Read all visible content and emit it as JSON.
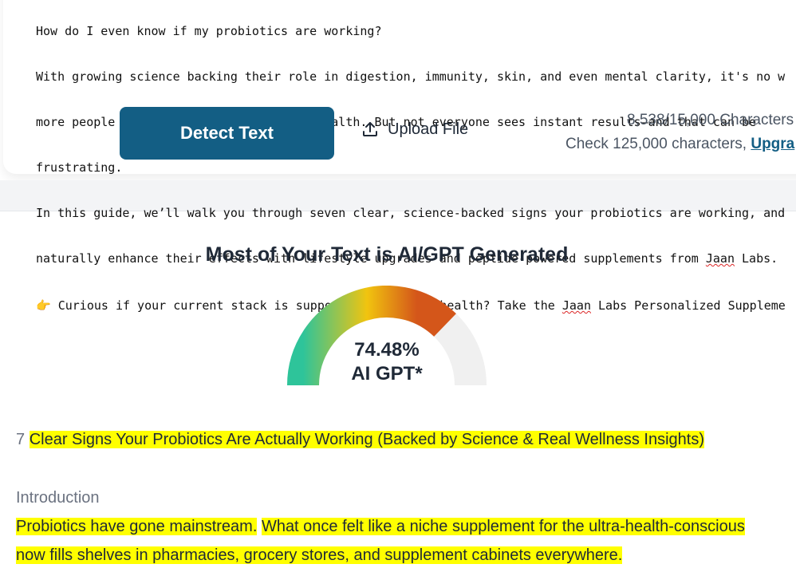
{
  "editor": {
    "lines": [
      "How do I even know if my probiotics are working?",
      "With growing science backing their role in digestion, immunity, skin, and even mental clarity, it's no w",
      "more people are investing in their gut health. But not everyone sees instant results—and that can be",
      "frustrating.",
      "In this guide, we’ll walk you through seven clear, science-backed signs your probiotics are working, and",
      "naturally enhance their effects with lifestyle upgrades and peptide-powered supplements from "
    ],
    "line6_brand": "Jaan",
    "line6_tail": " Labs.",
    "line7_emoji": "👉",
    "line7_text": " Curious if your current stack is supporting your gut health? Take the ",
    "line7_brand": "Jaan",
    "line7_tail": " Labs Personalized Suppleme"
  },
  "actions": {
    "detect_label": "Detect Text",
    "upload_label": "Upload File",
    "char_count": "8,538/15,000 Characters",
    "check_text": "Check 125,000 characters, ",
    "upgrade_label": "Upgra"
  },
  "result": {
    "title": "Most of Your Text is AI/GPT Generated",
    "percent": "74.48%",
    "percent_value": 74.48,
    "label": "AI GPT*",
    "colors": {
      "start": "#2ec49a",
      "mid": "#f1c40f",
      "end": "#d4561a",
      "track": "#f0f0f0"
    }
  },
  "analysis": {
    "heading_number": "7",
    "heading_text": "Clear Signs Your Probiotics Are Actually Working (Backed by Science & Real Wellness Insights)",
    "intro_label": "Introduction",
    "para1_s1": "Probiotics have gone mainstream.",
    "para1_s2": "What once felt like a niche supplement for the ultra-health-conscious ",
    "para1_s3": "now fills shelves in pharmacies, grocery stores, and supplement cabinets everywhere."
  },
  "highlight_color": "#ffff00",
  "accent_color": "#135e84"
}
